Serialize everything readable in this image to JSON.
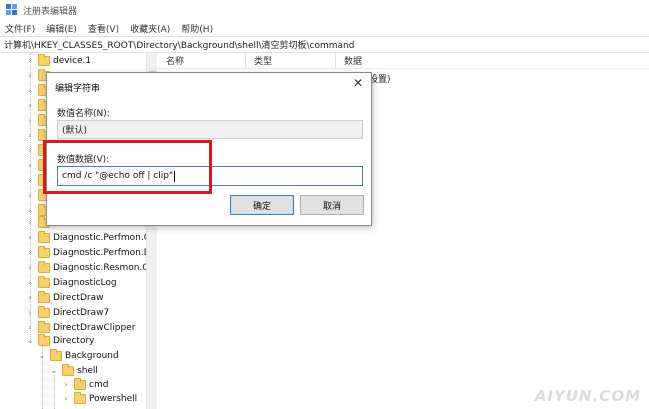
{
  "window": {
    "title": "注册表编辑器"
  },
  "menu": [
    "文件(F)",
    "编辑(E)",
    "查看(V)",
    "收藏夹(A)",
    "帮助(H)"
  ],
  "address": "计算机\\HKEY_CLASSES_ROOT\\Directory\\Background\\shell\\清空剪切板\\command",
  "tree": {
    "items": [
      {
        "label": "device.1"
      },
      {
        "label": ""
      },
      {
        "label": ""
      },
      {
        "label": ""
      },
      {
        "label": ""
      },
      {
        "label": ""
      },
      {
        "label": ""
      },
      {
        "label": ""
      },
      {
        "label": ""
      },
      {
        "label": ""
      },
      {
        "label": ""
      },
      {
        "label": ""
      },
      {
        "label": "Diagnostic.Perfmon.Co"
      },
      {
        "label": "Diagnostic.Perfmon.Do"
      },
      {
        "label": "Diagnostic.Resmon.Co"
      },
      {
        "label": "DiagnosticLog"
      },
      {
        "label": "DirectDraw"
      },
      {
        "label": "DirectDraw7"
      },
      {
        "label": "DirectDrawClipper"
      },
      {
        "label": "Directory"
      },
      {
        "label": "Background"
      },
      {
        "label": "shell"
      },
      {
        "label": "cmd"
      },
      {
        "label": "Powershell"
      }
    ]
  },
  "list": {
    "columns": {
      "name": "名称",
      "type": "类型",
      "data": "数据"
    },
    "peek_value": "设置)"
  },
  "dialog": {
    "title": "编辑字符串",
    "close_glyph": "✕",
    "name_label": "数值名称(N):",
    "name_value": "(默认)",
    "data_label": "数值数据(V):",
    "data_value": "cmd /c \"@echo off | clip\"",
    "ok_label": "确定",
    "cancel_label": "取消"
  },
  "watermark": "AIYUN.COM",
  "colors": {
    "highlight_border": "#e0161e",
    "focus_border": "#3c7fd0",
    "folder_fill": "#f6d169"
  }
}
